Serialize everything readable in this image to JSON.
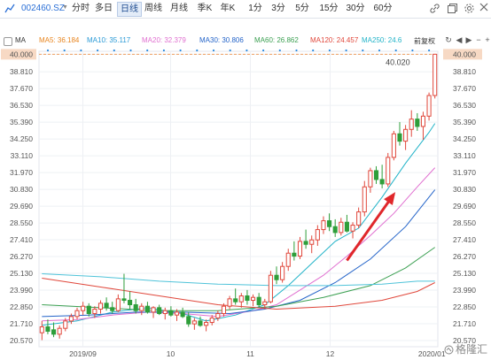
{
  "toolbar": {
    "ticker": "002460.SZ",
    "timeframes": [
      "分时",
      "多日",
      "日线",
      "周线",
      "月线",
      "季K",
      "年K",
      "1分",
      "3分",
      "5分",
      "15分",
      "30分",
      "60分"
    ],
    "active_timeframe": "日线",
    "settings_label": "设置"
  },
  "ma_bar": {
    "title": "MA",
    "adjust_label": "前复权",
    "items": [
      {
        "label": "MA5: 36.184",
        "color": "#e8841d"
      },
      {
        "label": "MA10: 35.117",
        "color": "#2a9ad6"
      },
      {
        "label": "MA20: 32.379",
        "color": "#e06fd0"
      },
      {
        "label": "MA30: 30.806",
        "color": "#2464c9"
      },
      {
        "label": "MA60: 26.862",
        "color": "#3ca052"
      },
      {
        "label": "MA120: 24.457",
        "color": "#e0473b"
      },
      {
        "label": "MA250: 24.6",
        "color": "#21b3c8"
      }
    ]
  },
  "watermark": "格隆汇",
  "chart_data": {
    "type": "candlestick",
    "x_labels": [
      "2019/09",
      "10",
      "11",
      "12",
      "2020/01"
    ],
    "y_ticks": [
      20.57,
      21.71,
      22.85,
      23.99,
      25.13,
      26.27,
      27.41,
      28.55,
      29.69,
      30.83,
      31.97,
      33.11,
      34.25,
      35.39,
      36.53,
      37.67,
      38.81,
      40.0
    ],
    "y_range": [
      20.15,
      40.2
    ],
    "price_level_line": 40.0,
    "max_label": "40.020",
    "up_color": "#e0473b",
    "down_color": "#2e9e3a",
    "candles": [
      {
        "o": 21.1,
        "h": 21.9,
        "l": 20.6,
        "c": 21.5
      },
      {
        "o": 21.5,
        "h": 22.0,
        "l": 21.0,
        "c": 21.2
      },
      {
        "o": 21.3,
        "h": 21.8,
        "l": 20.8,
        "c": 21.0
      },
      {
        "o": 21.0,
        "h": 21.6,
        "l": 20.7,
        "c": 21.4
      },
      {
        "o": 21.4,
        "h": 22.1,
        "l": 21.2,
        "c": 21.9
      },
      {
        "o": 21.9,
        "h": 22.4,
        "l": 21.7,
        "c": 22.2
      },
      {
        "o": 22.2,
        "h": 22.8,
        "l": 22.0,
        "c": 22.6
      },
      {
        "o": 22.6,
        "h": 23.2,
        "l": 22.3,
        "c": 22.9
      },
      {
        "o": 22.9,
        "h": 23.1,
        "l": 22.2,
        "c": 22.4
      },
      {
        "o": 22.4,
        "h": 22.9,
        "l": 22.1,
        "c": 22.7
      },
      {
        "o": 22.7,
        "h": 23.3,
        "l": 22.4,
        "c": 23.1
      },
      {
        "o": 23.1,
        "h": 23.5,
        "l": 22.6,
        "c": 22.8
      },
      {
        "o": 22.8,
        "h": 23.2,
        "l": 22.4,
        "c": 22.6
      },
      {
        "o": 22.6,
        "h": 23.7,
        "l": 22.5,
        "c": 23.4
      },
      {
        "o": 23.4,
        "h": 25.1,
        "l": 23.1,
        "c": 23.3
      },
      {
        "o": 23.3,
        "h": 23.9,
        "l": 22.7,
        "c": 23.0
      },
      {
        "o": 23.0,
        "h": 23.4,
        "l": 22.4,
        "c": 22.6
      },
      {
        "o": 22.6,
        "h": 23.1,
        "l": 22.3,
        "c": 22.9
      },
      {
        "o": 22.9,
        "h": 23.2,
        "l": 22.4,
        "c": 22.5
      },
      {
        "o": 22.5,
        "h": 22.9,
        "l": 22.1,
        "c": 22.8
      },
      {
        "o": 22.8,
        "h": 23.0,
        "l": 22.3,
        "c": 22.4
      },
      {
        "o": 22.4,
        "h": 22.8,
        "l": 22.0,
        "c": 22.6
      },
      {
        "o": 22.6,
        "h": 22.9,
        "l": 22.2,
        "c": 22.3
      },
      {
        "o": 22.3,
        "h": 22.7,
        "l": 21.9,
        "c": 22.5
      },
      {
        "o": 22.5,
        "h": 22.8,
        "l": 22.1,
        "c": 22.2
      },
      {
        "o": 22.2,
        "h": 22.5,
        "l": 21.5,
        "c": 21.7
      },
      {
        "o": 21.7,
        "h": 22.1,
        "l": 21.3,
        "c": 21.9
      },
      {
        "o": 21.9,
        "h": 22.2,
        "l": 21.5,
        "c": 21.6
      },
      {
        "o": 21.6,
        "h": 22.0,
        "l": 21.2,
        "c": 21.8
      },
      {
        "o": 21.8,
        "h": 22.3,
        "l": 21.6,
        "c": 22.1
      },
      {
        "o": 22.1,
        "h": 22.6,
        "l": 21.9,
        "c": 22.4
      },
      {
        "o": 22.4,
        "h": 23.1,
        "l": 22.2,
        "c": 22.9
      },
      {
        "o": 22.9,
        "h": 23.6,
        "l": 22.7,
        "c": 23.4
      },
      {
        "o": 23.4,
        "h": 24.1,
        "l": 23.0,
        "c": 23.2
      },
      {
        "o": 23.2,
        "h": 23.8,
        "l": 22.8,
        "c": 23.6
      },
      {
        "o": 23.6,
        "h": 24.0,
        "l": 23.0,
        "c": 23.3
      },
      {
        "o": 23.3,
        "h": 23.7,
        "l": 22.9,
        "c": 23.5
      },
      {
        "o": 23.5,
        "h": 23.8,
        "l": 22.8,
        "c": 23.0
      },
      {
        "o": 23.0,
        "h": 23.4,
        "l": 22.7,
        "c": 23.2
      },
      {
        "o": 23.2,
        "h": 25.3,
        "l": 23.1,
        "c": 25.0
      },
      {
        "o": 25.0,
        "h": 25.6,
        "l": 24.4,
        "c": 24.7
      },
      {
        "o": 24.7,
        "h": 25.9,
        "l": 24.5,
        "c": 25.6
      },
      {
        "o": 25.6,
        "h": 26.8,
        "l": 25.3,
        "c": 26.5
      },
      {
        "o": 26.5,
        "h": 27.3,
        "l": 26.0,
        "c": 26.3
      },
      {
        "o": 26.3,
        "h": 27.6,
        "l": 26.1,
        "c": 27.3
      },
      {
        "o": 27.3,
        "h": 28.1,
        "l": 26.8,
        "c": 27.1
      },
      {
        "o": 27.1,
        "h": 27.7,
        "l": 26.5,
        "c": 27.4
      },
      {
        "o": 27.4,
        "h": 28.4,
        "l": 27.0,
        "c": 28.1
      },
      {
        "o": 28.1,
        "h": 29.0,
        "l": 27.8,
        "c": 28.7
      },
      {
        "o": 28.7,
        "h": 29.2,
        "l": 28.0,
        "c": 28.3
      },
      {
        "o": 28.3,
        "h": 28.8,
        "l": 27.6,
        "c": 27.9
      },
      {
        "o": 27.9,
        "h": 28.9,
        "l": 27.7,
        "c": 28.6
      },
      {
        "o": 28.6,
        "h": 29.1,
        "l": 27.9,
        "c": 28.0
      },
      {
        "o": 28.0,
        "h": 28.6,
        "l": 27.5,
        "c": 28.4
      },
      {
        "o": 28.4,
        "h": 29.6,
        "l": 28.2,
        "c": 29.3
      },
      {
        "o": 29.3,
        "h": 31.4,
        "l": 29.0,
        "c": 31.0
      },
      {
        "o": 31.0,
        "h": 32.3,
        "l": 30.6,
        "c": 32.1
      },
      {
        "o": 32.1,
        "h": 32.4,
        "l": 31.2,
        "c": 31.5
      },
      {
        "o": 31.5,
        "h": 32.5,
        "l": 30.9,
        "c": 31.2
      },
      {
        "o": 31.2,
        "h": 33.3,
        "l": 31.0,
        "c": 33.0
      },
      {
        "o": 33.0,
        "h": 34.8,
        "l": 32.8,
        "c": 34.6
      },
      {
        "o": 34.6,
        "h": 35.4,
        "l": 33.8,
        "c": 34.1
      },
      {
        "o": 34.1,
        "h": 35.2,
        "l": 33.5,
        "c": 34.9
      },
      {
        "o": 34.9,
        "h": 36.2,
        "l": 34.4,
        "c": 35.6
      },
      {
        "o": 35.6,
        "h": 36.0,
        "l": 34.8,
        "c": 35.1
      },
      {
        "o": 35.1,
        "h": 36.1,
        "l": 34.2,
        "c": 35.8
      },
      {
        "o": 35.8,
        "h": 37.4,
        "l": 35.5,
        "c": 37.2
      },
      {
        "o": 37.2,
        "h": 40.02,
        "l": 37.0,
        "c": 40.0
      }
    ],
    "moving_averages": [
      {
        "name": "MA10",
        "color": "#21b3c8",
        "values": [
          [
            0,
            21.6
          ],
          [
            6,
            21.9
          ],
          [
            12,
            22.5
          ],
          [
            18,
            22.8
          ],
          [
            24,
            22.4
          ],
          [
            28,
            21.9
          ],
          [
            33,
            22.3
          ],
          [
            38,
            23.0
          ],
          [
            42,
            24.3
          ],
          [
            46,
            25.8
          ],
          [
            50,
            27.3
          ],
          [
            54,
            28.2
          ],
          [
            58,
            30.3
          ],
          [
            62,
            32.6
          ],
          [
            66,
            34.7
          ],
          [
            67,
            35.3
          ]
        ]
      },
      {
        "name": "MA20",
        "color": "#e06fd0",
        "values": [
          [
            0,
            21.9
          ],
          [
            6,
            22.0
          ],
          [
            12,
            22.3
          ],
          [
            18,
            22.5
          ],
          [
            24,
            22.4
          ],
          [
            30,
            22.2
          ],
          [
            36,
            22.6
          ],
          [
            40,
            23.0
          ],
          [
            44,
            24.0
          ],
          [
            48,
            25.0
          ],
          [
            52,
            26.3
          ],
          [
            56,
            27.7
          ],
          [
            60,
            29.2
          ],
          [
            64,
            31.0
          ],
          [
            67,
            32.3
          ]
        ]
      },
      {
        "name": "MA30",
        "color": "#2464c9",
        "values": [
          [
            0,
            22.2
          ],
          [
            8,
            22.3
          ],
          [
            16,
            22.5
          ],
          [
            24,
            22.5
          ],
          [
            32,
            22.4
          ],
          [
            38,
            22.7
          ],
          [
            44,
            23.3
          ],
          [
            50,
            24.5
          ],
          [
            56,
            26.1
          ],
          [
            62,
            28.3
          ],
          [
            67,
            30.8
          ]
        ]
      },
      {
        "name": "MA60",
        "color": "#3ca052",
        "values": [
          [
            0,
            23.0
          ],
          [
            10,
            22.8
          ],
          [
            20,
            22.6
          ],
          [
            30,
            22.6
          ],
          [
            40,
            22.9
          ],
          [
            48,
            23.5
          ],
          [
            56,
            24.3
          ],
          [
            62,
            25.5
          ],
          [
            67,
            26.9
          ]
        ]
      },
      {
        "name": "MA120",
        "color": "#e0473b",
        "values": [
          [
            0,
            24.8
          ],
          [
            10,
            24.2
          ],
          [
            20,
            23.6
          ],
          [
            30,
            23.0
          ],
          [
            40,
            22.7
          ],
          [
            50,
            22.9
          ],
          [
            58,
            23.3
          ],
          [
            64,
            23.9
          ],
          [
            67,
            24.5
          ]
        ]
      },
      {
        "name": "MA250",
        "color": "#4fc3d9",
        "values": [
          [
            0,
            25.1
          ],
          [
            10,
            24.9
          ],
          [
            20,
            24.6
          ],
          [
            30,
            24.4
          ],
          [
            40,
            24.3
          ],
          [
            50,
            24.3
          ],
          [
            58,
            24.4
          ],
          [
            64,
            24.6
          ],
          [
            67,
            24.6
          ]
        ]
      }
    ],
    "annotation": {
      "type": "arrow",
      "color": "#e0272b",
      "from_index": 52,
      "from_value": 26.0,
      "to_index": 60,
      "to_value": 30.5
    }
  }
}
